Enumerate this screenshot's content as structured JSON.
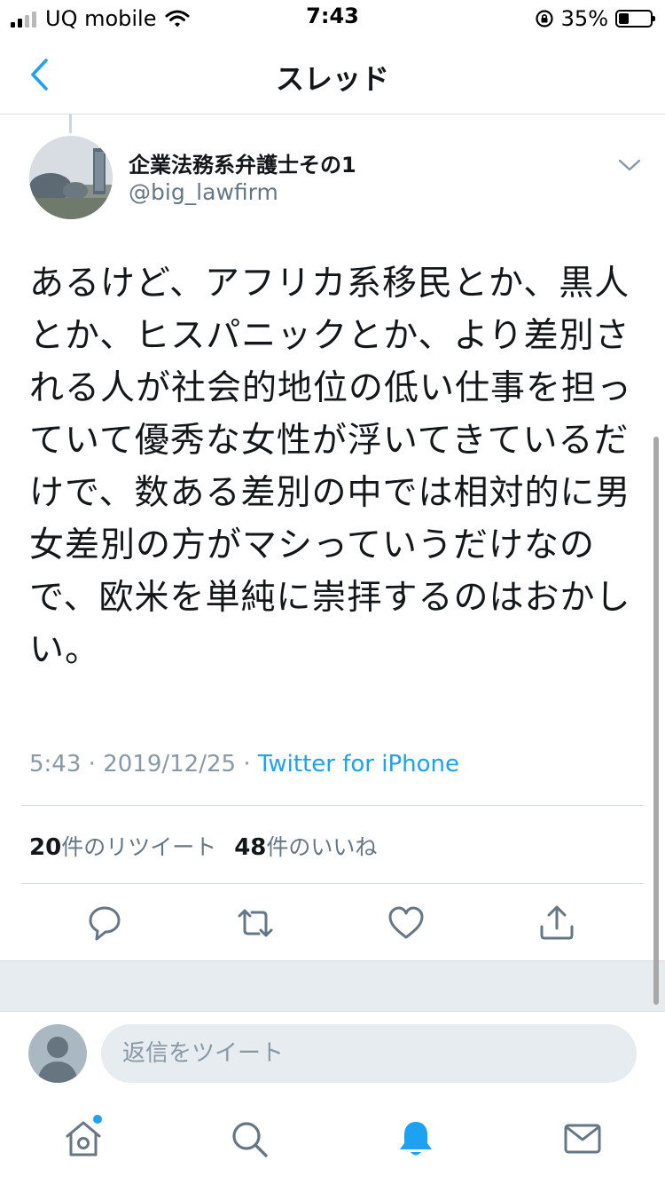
{
  "status_bar": {
    "carrier": "UQ mobile",
    "time": "7:43",
    "battery": "35%"
  },
  "nav": {
    "title": "スレッド"
  },
  "tweet": {
    "display_name": "企業法務系弁護士その1",
    "handle": "@big_lawfirm",
    "text_lines": [
      "あるけど、アフリカ系移民とか、黒人",
      "とか、ヒスパニックとか、より差別さ",
      "れる人が社会的地位の低い仕事を担っ",
      "ていて優秀な女性が浮いてきているだ",
      "けで、数ある差別の中では相対的に男",
      "女差別の方がマシっていうだけなの",
      "で、欧米を単純に崇拝するのはおかし",
      "い。"
    ],
    "time": "5:43",
    "date": "2019/12/25",
    "source": "Twitter for iPhone",
    "retweet_count": "20",
    "retweet_label": "件のリツイート",
    "like_count": "48",
    "like_label": "件のいいね"
  },
  "reply": {
    "placeholder": "返信をツイート"
  },
  "colors": {
    "accent": "#1da1f2",
    "text": "#14171a",
    "secondary": "#657786",
    "icon": "#657786"
  },
  "icons": {
    "back": "chevron-left-icon",
    "more": "chevron-down-icon",
    "reply": "reply-icon",
    "retweet": "retweet-icon",
    "like": "heart-icon",
    "share": "share-icon",
    "home": "home-icon",
    "search": "search-icon",
    "notifications": "bell-icon",
    "messages": "mail-icon"
  }
}
